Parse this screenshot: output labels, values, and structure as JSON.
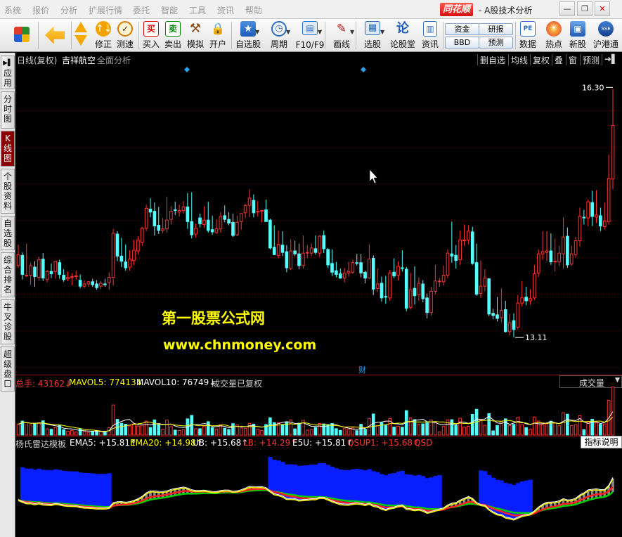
{
  "menubar": {
    "items": [
      "系统",
      "报价",
      "分析",
      "扩展行情",
      "委托",
      "智能",
      "工具",
      "资讯",
      "帮助"
    ],
    "brand": "同花顺",
    "title": "- A股技术分析",
    "window_buttons": [
      "—",
      "❐",
      "✕"
    ]
  },
  "toolbar": {
    "buttons": [
      {
        "label": "修正",
        "icon": "↑↓"
      },
      {
        "label": "测速",
        "icon": "✓"
      },
      {
        "label": "买入",
        "icon": "买"
      },
      {
        "label": "卖出",
        "icon": "卖"
      },
      {
        "label": "模拟",
        "icon": "⚒"
      },
      {
        "label": "开户",
        "icon": "🔒"
      },
      {
        "label": "自选股",
        "icon": "★"
      },
      {
        "label": "周期",
        "icon": "◷"
      },
      {
        "label": "F10/F9",
        "icon": "▤"
      },
      {
        "label": "画线",
        "icon": "✎"
      },
      {
        "label": "选股",
        "icon": "▦"
      },
      {
        "label": "论股堂",
        "icon": "论"
      },
      {
        "label": "资讯",
        "icon": "▥"
      },
      {
        "label": "数据",
        "icon": "PE"
      },
      {
        "label": "热点",
        "icon": "☀"
      },
      {
        "label": "新股",
        "icon": "▣"
      },
      {
        "label": "沪港通",
        "icon": "SSE"
      }
    ],
    "pills": [
      "资金",
      "BBD",
      "研报",
      "预测"
    ]
  },
  "sidebar": {
    "tabs": [
      "应用",
      "分时图",
      "K线图",
      "个股资料",
      "自选股",
      "综合排名",
      "牛叉诊股",
      "超级盘口"
    ],
    "active": "K线图"
  },
  "kline": {
    "mode": "日线(复权)",
    "stock_name": "吉祥航空",
    "analysis": "全面分析",
    "right_buttons": [
      "删自选",
      "均线",
      "复权",
      "叠",
      "窗",
      "预测"
    ],
    "high_label": "16.30",
    "low_label": "13.11",
    "cai_marker": "财",
    "watermark_1": "第一股票公式网",
    "watermark_2": "www.chnmoney.com"
  },
  "volume": {
    "total_label": "总手: 43162↓",
    "mavol5_label": "MAVOL5: 77413↓",
    "mavol10_label": "MAVOL10: 76749↓",
    "note": "成交量已复权",
    "select_value": "成交量"
  },
  "indicator": {
    "name": "杨氏雷达模板",
    "ema5": "EMA5: +15.81↑",
    "ema20": "EMA20: +14.98↑",
    "ub": "UB: +15.68↑",
    "lb": "LB: +14.29↑",
    "e5u": "E5U: +15.81↑",
    "qsup1": "QSUP1: +15.68↑",
    "qsd": "QSD",
    "help_button": "指标说明"
  },
  "colors": {
    "up": "#ff3232",
    "down": "#54ffff",
    "ma_white": "#ffffff",
    "ma_yellow": "#ffff00",
    "ma_green": "#00d000",
    "ma_red": "#ff2020",
    "band_blue": "#0a1fff",
    "grid": "#8b0000"
  },
  "chart_data": {
    "type": "candlestick",
    "series": {
      "open": [
        13.89,
        14.03,
        13.75,
        13.76,
        13.87,
        13.73,
        13.98,
        13.7,
        13.81,
        13.81,
        13.93,
        13.76,
        13.71,
        13.74,
        13.75,
        13.69,
        13.61,
        13.64,
        13.67,
        13.64,
        13.61,
        13.64,
        13.66,
        13.73,
        14.32,
        14.02,
        13.94,
        13.87,
        13.96,
        14.09,
        14.21,
        14.4,
        14.66,
        14.63,
        14.44,
        14.37,
        14.39,
        14.52,
        14.65,
        14.62,
        14.64,
        14.69,
        14.49,
        14.32,
        14.54,
        14.45,
        14.51,
        14.38,
        14.34,
        14.39,
        14.57,
        14.52,
        14.48,
        14.31,
        14.49,
        14.61,
        14.71,
        14.78,
        14.62,
        14.64,
        14.65,
        14.51,
        14.14,
        14.03,
        14.17,
        14.08,
        13.85,
        14.09,
        14.05,
        13.89,
        14.06,
        14.06,
        14.12,
        14.06,
        14.3,
        14.11,
        13.92,
        13.82,
        13.78,
        13.72,
        13.79,
        13.8,
        13.93,
        13.93,
        13.8,
        13.72,
        13.99,
        13.58,
        13.65,
        13.47,
        13.45,
        13.8,
        13.76,
        13.86,
        13.84,
        13.32,
        13.58,
        13.49,
        13.64,
        13.45,
        13.25,
        13.54,
        13.68,
        13.67,
        13.76,
        14.05,
        14.03,
        13.97,
        14.23,
        14.24,
        14.35,
        13.93,
        13.51,
        13.61,
        13.71,
        13.24,
        13.22,
        13.18,
        13.29,
        12.99,
        13.14,
        13.05,
        13.38,
        13.46,
        13.41,
        13.45,
        13.79,
        14.05,
        14.07,
        14.09,
        13.95,
        13.94,
        14.05,
        14.29,
        13.91,
        14.04,
        14.23,
        14.55,
        14.54,
        14.75,
        14.55,
        14.57,
        14.42,
        14.49,
        15.07
      ],
      "high": [
        14.18,
        14.07,
        14.19,
        13.93,
        13.95,
        14.01,
        14.06,
        13.83,
        13.92,
        13.91,
        13.97,
        13.84,
        13.81,
        13.79,
        13.82,
        13.77,
        13.69,
        13.68,
        13.71,
        13.69,
        13.68,
        13.71,
        13.8,
        14.39,
        14.36,
        14.27,
        14.18,
        14.1,
        14.24,
        14.29,
        14.42,
        14.72,
        14.81,
        14.75,
        14.69,
        14.54,
        14.83,
        14.7,
        14.76,
        14.72,
        14.77,
        14.88,
        14.89,
        14.46,
        14.6,
        14.7,
        14.76,
        14.57,
        14.52,
        14.62,
        14.71,
        14.62,
        14.6,
        14.57,
        14.58,
        14.73,
        14.93,
        14.86,
        14.77,
        14.65,
        14.79,
        14.53,
        14.44,
        14.37,
        14.36,
        14.17,
        14.25,
        14.23,
        14.19,
        14.3,
        14.17,
        14.19,
        14.3,
        14.31,
        14.37,
        14.13,
        14.11,
        13.94,
        13.85,
        13.86,
        13.94,
        13.97,
        14.05,
        14.05,
        13.82,
        14.18,
        14.03,
        13.85,
        13.74,
        13.75,
        13.83,
        13.99,
        13.95,
        14.1,
        13.87,
        13.79,
        13.88,
        13.73,
        13.69,
        13.51,
        13.6,
        13.9,
        13.72,
        13.89,
        14.11,
        14.49,
        14.17,
        14.37,
        14.45,
        14.44,
        14.42,
        14.19,
        13.96,
        13.84,
        13.72,
        13.3,
        13.46,
        13.58,
        13.41,
        13.23,
        13.24,
        13.49,
        13.68,
        13.6,
        13.57,
        13.9,
        14.11,
        14.36,
        14.36,
        14.33,
        14.26,
        14.16,
        14.55,
        14.41,
        14.16,
        14.28,
        14.68,
        14.65,
        14.79,
        14.91,
        14.92,
        14.68,
        14.75,
        15.4,
        16.3
      ],
      "low": [
        13.86,
        13.7,
        13.73,
        13.63,
        13.6,
        13.69,
        13.68,
        13.66,
        13.72,
        13.71,
        13.71,
        13.67,
        13.68,
        13.62,
        13.7,
        13.58,
        13.58,
        13.6,
        13.6,
        13.56,
        13.57,
        13.6,
        13.56,
        13.62,
        13.95,
        13.87,
        13.82,
        13.82,
        13.9,
        14.04,
        14.16,
        14.36,
        14.55,
        14.3,
        14.32,
        14.33,
        14.34,
        14.45,
        14.58,
        14.56,
        14.6,
        14.39,
        14.26,
        14.27,
        14.41,
        14.4,
        14.34,
        14.31,
        14.32,
        14.34,
        14.48,
        14.44,
        14.28,
        14.29,
        14.38,
        14.54,
        14.55,
        14.55,
        14.56,
        14.48,
        14.49,
        14.11,
        14.03,
        13.99,
        14.02,
        13.8,
        13.83,
        14.02,
        13.84,
        13.85,
        13.99,
        14.02,
        14.04,
        14.01,
        14.06,
        13.86,
        13.75,
        13.73,
        13.71,
        13.66,
        13.74,
        13.78,
        13.89,
        13.73,
        13.65,
        13.71,
        13.49,
        13.53,
        13.4,
        13.37,
        13.41,
        13.72,
        13.69,
        13.81,
        13.27,
        13.29,
        13.36,
        13.41,
        13.39,
        13.17,
        13.21,
        13.5,
        13.6,
        13.62,
        13.72,
        13.93,
        13.85,
        13.9,
        14.16,
        14.18,
        13.9,
        13.48,
        13.45,
        13.54,
        13.2,
        13.16,
        13.13,
        13.12,
        12.98,
        12.94,
        12.91,
        13.02,
        13.33,
        13.35,
        13.36,
        13.42,
        13.74,
        13.97,
        13.95,
        13.9,
        13.81,
        13.88,
        13.85,
        13.86,
        13.89,
        14.0,
        14.15,
        14.45,
        14.43,
        14.43,
        14.47,
        14.36,
        14.38,
        14.45,
        14.93
      ],
      "close": [
        14.04,
        13.77,
        13.76,
        13.89,
        13.74,
        13.97,
        13.72,
        13.81,
        13.78,
        13.95,
        13.77,
        13.7,
        13.73,
        13.74,
        13.75,
        13.61,
        13.64,
        13.67,
        13.63,
        13.59,
        13.65,
        13.63,
        13.73,
        14.33,
        14.02,
        13.95,
        13.86,
        13.98,
        14.1,
        14.24,
        14.4,
        14.67,
        14.62,
        14.43,
        14.37,
        14.39,
        14.51,
        14.63,
        14.64,
        14.64,
        14.69,
        14.49,
        14.31,
        14.4,
        14.46,
        14.51,
        14.37,
        14.35,
        14.39,
        14.56,
        14.52,
        14.47,
        14.3,
        14.48,
        14.6,
        14.71,
        14.81,
        14.61,
        14.63,
        14.64,
        14.49,
        14.13,
        14.04,
        14.18,
        14.07,
        13.86,
        14.09,
        14.05,
        13.89,
        14.06,
        14.07,
        14.13,
        14.07,
        14.29,
        14.12,
        13.9,
        13.8,
        13.77,
        13.72,
        13.79,
        13.81,
        13.93,
        13.92,
        13.79,
        13.72,
        13.98,
        13.57,
        13.64,
        13.45,
        13.46,
        13.79,
        13.75,
        13.88,
        13.85,
        13.31,
        13.56,
        13.48,
        13.65,
        13.44,
        13.25,
        13.54,
        13.68,
        13.68,
        13.76,
        14.06,
        14.02,
        13.96,
        14.24,
        14.24,
        14.36,
        13.92,
        13.5,
        13.61,
        13.72,
        13.23,
        13.21,
        13.17,
        13.28,
        12.99,
        13.11,
        13.02,
        13.38,
        13.45,
        13.41,
        13.44,
        13.78,
        14.05,
        14.08,
        14.09,
        13.94,
        13.95,
        14.06,
        14.28,
        13.9,
        14.05,
        14.23,
        14.56,
        14.54,
        14.76,
        14.56,
        14.58,
        14.43,
        14.5,
        15.08,
        15.8
      ]
    },
    "ylim": [
      12.5,
      16.6
    ],
    "annotations": [
      "16.30",
      "13.11"
    ]
  }
}
